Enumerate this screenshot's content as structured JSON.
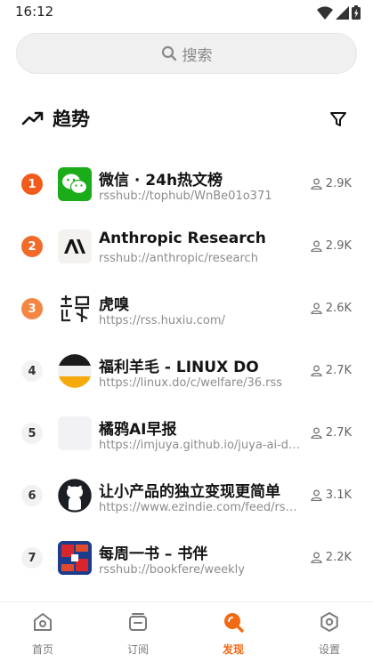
{
  "status_bar": {
    "time": "16:12"
  },
  "search": {
    "placeholder": "搜索"
  },
  "section": {
    "title": "趋势"
  },
  "colors": {
    "accent": "#f26a14",
    "rank_hot": "#f25b1c"
  },
  "feeds": [
    {
      "rank": "1",
      "title": "微信 · 24h热文榜",
      "url": "rsshub://tophub/WnBe01o371",
      "subscribers": "2.9K",
      "icon": "wechat-logo"
    },
    {
      "rank": "2",
      "title": "Anthropic Research",
      "url": "rsshub://anthropic/research",
      "subscribers": "2.9K",
      "icon": "anthropic-logo"
    },
    {
      "rank": "3",
      "title": "虎嗅",
      "url": "https://rss.huxiu.com/",
      "subscribers": "2.6K",
      "icon": "huxiu-logo"
    },
    {
      "rank": "4",
      "title": "福利羊毛 - LINUX DO",
      "url": "https://linux.do/c/welfare/36.rss",
      "subscribers": "2.7K",
      "icon": "linuxdo-logo"
    },
    {
      "rank": "5",
      "title": "橘鸦AI早报",
      "url": "https://imjuya.github.io/juya-ai-daily",
      "subscribers": "2.7K",
      "icon": "placeholder-logo"
    },
    {
      "rank": "6",
      "title": "让小产品的独立变现更简单",
      "url": "https://www.ezindie.com/feed/rss.xml",
      "subscribers": "3.1K",
      "icon": "github-logo"
    },
    {
      "rank": "7",
      "title": "每周一书 – 书伴",
      "url": "rsshub://bookfere/weekly",
      "subscribers": "2.2K",
      "icon": "bookfere-logo"
    }
  ],
  "nav": {
    "home": "首页",
    "subscriptions": "订阅",
    "discover": "发现",
    "settings": "设置"
  }
}
